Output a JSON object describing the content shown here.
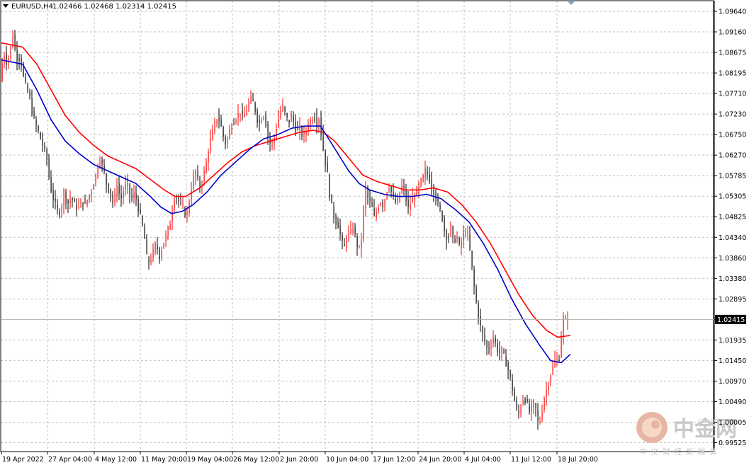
{
  "header": {
    "symbol": "EURUSD,H4",
    "quote": "1.02466 1.02468 1.02314 1.02415"
  },
  "watermark": {
    "brand": "中金网",
    "domain": "CNGOLD.ORG",
    "tagline": "中 文 财 经 新 媒 体"
  },
  "colors": {
    "bull": "#ff0000",
    "bear": "#000000",
    "ma_slow": "#ff0000",
    "ma_fast": "#0000cc",
    "grid": "#c0c0c0",
    "price_tag": "#000000"
  },
  "chart_data": {
    "type": "candlestick",
    "title": "EURUSD,H4",
    "ylim": [
      0.99525,
      1.0964
    ],
    "y_ticks": [
      "1.09640",
      "1.09160",
      "1.08675",
      "1.08195",
      "1.07710",
      "1.07230",
      "1.06750",
      "1.06270",
      "1.05785",
      "1.05305",
      "1.04825",
      "1.04340",
      "1.03860",
      "1.03380",
      "1.02895",
      "1.02415",
      "1.01935",
      "1.01450",
      "1.00970",
      "1.00490",
      "1.00005",
      "0.99525"
    ],
    "x_labels": [
      "19 Apr 2022",
      "27 Apr 04:00",
      "4 May 12:00",
      "11 May 20:00",
      "19 May 04:00",
      "26 May 12:00",
      "2 Jun 20:00",
      "10 Jun 04:00",
      "17 Jun 12:00",
      "24 Jun 20:00",
      "4 Jul 04:00",
      "11 Jul 12:00",
      "18 Jul 20:00"
    ],
    "current_price": "1.02415",
    "path_points": [
      [
        0,
        1.08
      ],
      [
        5,
        1.087
      ],
      [
        10,
        1.084
      ],
      [
        15,
        1.088
      ],
      [
        19,
        1.092
      ],
      [
        22,
        1.085
      ],
      [
        26,
        1.086
      ],
      [
        30,
        1.084
      ],
      [
        34,
        1.08
      ],
      [
        38,
        1.078
      ],
      [
        42,
        1.076
      ],
      [
        46,
        1.072
      ],
      [
        50,
        1.07
      ],
      [
        54,
        1.068
      ],
      [
        58,
        1.066
      ],
      [
        62,
        1.064
      ],
      [
        66,
        1.062
      ],
      [
        70,
        1.056
      ],
      [
        74,
        1.053
      ],
      [
        78,
        1.051
      ],
      [
        82,
        1.049
      ],
      [
        86,
        1.05
      ],
      [
        90,
        1.054
      ],
      [
        95,
        1.051
      ],
      [
        100,
        1.053
      ],
      [
        105,
        1.051
      ],
      [
        110,
        1.05
      ],
      [
        115,
        1.052
      ],
      [
        120,
        1.051
      ],
      [
        125,
        1.053
      ],
      [
        130,
        1.055
      ],
      [
        135,
        1.058
      ],
      [
        140,
        1.062
      ],
      [
        145,
        1.06
      ],
      [
        150,
        1.056
      ],
      [
        155,
        1.054
      ],
      [
        160,
        1.051
      ],
      [
        165,
        1.056
      ],
      [
        170,
        1.052
      ],
      [
        175,
        1.055
      ],
      [
        180,
        1.056
      ],
      [
        185,
        1.052
      ],
      [
        190,
        1.054
      ],
      [
        195,
        1.05
      ],
      [
        200,
        1.047
      ],
      [
        205,
        1.042
      ],
      [
        208,
        1.037
      ],
      [
        212,
        1.038
      ],
      [
        216,
        1.04
      ],
      [
        220,
        1.042
      ],
      [
        225,
        1.039
      ],
      [
        230,
        1.042
      ],
      [
        235,
        1.044
      ],
      [
        240,
        1.047
      ],
      [
        243,
        1.05
      ],
      [
        247,
        1.054
      ],
      [
        251,
        1.052
      ],
      [
        255,
        1.051
      ],
      [
        259,
        1.05
      ],
      [
        263,
        1.048
      ],
      [
        267,
        1.052
      ],
      [
        271,
        1.056
      ],
      [
        276,
        1.059
      ],
      [
        281,
        1.055
      ],
      [
        286,
        1.057
      ],
      [
        290,
        1.06
      ],
      [
        294,
        1.064
      ],
      [
        298,
        1.067
      ],
      [
        303,
        1.07
      ],
      [
        307,
        1.072
      ],
      [
        311,
        1.07
      ],
      [
        315,
        1.067
      ],
      [
        319,
        1.065
      ],
      [
        323,
        1.068
      ],
      [
        327,
        1.07
      ],
      [
        331,
        1.071
      ],
      [
        335,
        1.072
      ],
      [
        339,
        1.073
      ],
      [
        343,
        1.071
      ],
      [
        347,
        1.073
      ],
      [
        351,
        1.075
      ],
      [
        355,
        1.076
      ],
      [
        359,
        1.074
      ],
      [
        363,
        1.071
      ],
      [
        367,
        1.07
      ],
      [
        371,
        1.073
      ],
      [
        375,
        1.07
      ],
      [
        379,
        1.066
      ],
      [
        383,
        1.065
      ],
      [
        387,
        1.067
      ],
      [
        391,
        1.07
      ],
      [
        395,
        1.073
      ],
      [
        399,
        1.074
      ],
      [
        403,
        1.072
      ],
      [
        407,
        1.07
      ],
      [
        411,
        1.072
      ],
      [
        415,
        1.07
      ],
      [
        419,
        1.068
      ],
      [
        423,
        1.069
      ],
      [
        427,
        1.067
      ],
      [
        431,
        1.068
      ],
      [
        435,
        1.07
      ],
      [
        439,
        1.071
      ],
      [
        443,
        1.072
      ],
      [
        447,
        1.07
      ],
      [
        451,
        1.072
      ],
      [
        454,
        1.066
      ],
      [
        458,
        1.062
      ],
      [
        462,
        1.058
      ],
      [
        466,
        1.052
      ],
      [
        470,
        1.049
      ],
      [
        474,
        1.047
      ],
      [
        478,
        1.046
      ],
      [
        482,
        1.042
      ],
      [
        486,
        1.041
      ],
      [
        490,
        1.045
      ],
      [
        494,
        1.044
      ],
      [
        498,
        1.046
      ],
      [
        502,
        1.043
      ],
      [
        506,
        1.04
      ],
      [
        510,
        1.043
      ],
      [
        513,
        1.05
      ],
      [
        516,
        1.055
      ],
      [
        520,
        1.052
      ],
      [
        524,
        1.051
      ],
      [
        528,
        1.048
      ],
      [
        532,
        1.05
      ],
      [
        536,
        1.052
      ],
      [
        540,
        1.051
      ],
      [
        544,
        1.053
      ],
      [
        548,
        1.056
      ],
      [
        552,
        1.054
      ],
      [
        556,
        1.052
      ],
      [
        560,
        1.051
      ],
      [
        564,
        1.054
      ],
      [
        568,
        1.056
      ],
      [
        572,
        1.053
      ],
      [
        576,
        1.05
      ],
      [
        580,
        1.052
      ],
      [
        584,
        1.053
      ],
      [
        588,
        1.054
      ],
      [
        592,
        1.056
      ],
      [
        596,
        1.057
      ],
      [
        600,
        1.059
      ],
      [
        604,
        1.058
      ],
      [
        608,
        1.056
      ],
      [
        612,
        1.054
      ],
      [
        616,
        1.052
      ],
      [
        620,
        1.05
      ],
      [
        624,
        1.048
      ],
      [
        628,
        1.044
      ],
      [
        632,
        1.043
      ],
      [
        636,
        1.046
      ],
      [
        640,
        1.042
      ],
      [
        644,
        1.044
      ],
      [
        648,
        1.041
      ],
      [
        652,
        1.043
      ],
      [
        656,
        1.045
      ],
      [
        660,
        1.044
      ],
      [
        664,
        1.039
      ],
      [
        668,
        1.033
      ],
      [
        672,
        1.028
      ],
      [
        676,
        1.024
      ],
      [
        680,
        1.021
      ],
      [
        684,
        1.019
      ],
      [
        688,
        1.017
      ],
      [
        692,
        1.018
      ],
      [
        696,
        1.02
      ],
      [
        700,
        1.018
      ],
      [
        704,
        1.016
      ],
      [
        708,
        1.017
      ],
      [
        712,
        1.015
      ],
      [
        716,
        1.013
      ],
      [
        720,
        1.01
      ],
      [
        724,
        1.007
      ],
      [
        728,
        1.003
      ],
      [
        732,
        1.002
      ],
      [
        736,
        1.005
      ],
      [
        740,
        1.006
      ],
      [
        744,
        1.004
      ],
      [
        748,
        1.002
      ],
      [
        752,
        1.005
      ],
      [
        756,
        1.003
      ],
      [
        760,
        0.999
      ],
      [
        764,
        1.002
      ],
      [
        768,
        1.006
      ],
      [
        772,
        1.008
      ],
      [
        776,
        1.011
      ],
      [
        780,
        1.013
      ],
      [
        784,
        1.015
      ],
      [
        788,
        1.014
      ],
      [
        791,
        1.018
      ],
      [
        794,
        1.025
      ],
      [
        797,
        1.023
      ],
      [
        800,
        1.025
      ],
      [
        803,
        1.0242
      ]
    ],
    "ma_slow": [
      [
        0,
        1.089
      ],
      [
        30,
        1.088
      ],
      [
        50,
        1.084
      ],
      [
        70,
        1.078
      ],
      [
        90,
        1.072
      ],
      [
        110,
        1.068
      ],
      [
        130,
        1.065
      ],
      [
        150,
        1.0625
      ],
      [
        170,
        1.061
      ],
      [
        190,
        1.0595
      ],
      [
        210,
        1.057
      ],
      [
        230,
        1.0545
      ],
      [
        245,
        1.053
      ],
      [
        260,
        1.053
      ],
      [
        280,
        1.055
      ],
      [
        300,
        1.058
      ],
      [
        320,
        1.061
      ],
      [
        340,
        1.0635
      ],
      [
        360,
        1.065
      ],
      [
        380,
        1.066
      ],
      [
        400,
        1.067
      ],
      [
        420,
        1.068
      ],
      [
        440,
        1.0685
      ],
      [
        455,
        1.068
      ],
      [
        470,
        1.066
      ],
      [
        490,
        1.062
      ],
      [
        510,
        1.058
      ],
      [
        530,
        1.0565
      ],
      [
        550,
        1.0555
      ],
      [
        570,
        1.0545
      ],
      [
        590,
        1.0545
      ],
      [
        610,
        1.055
      ],
      [
        630,
        1.054
      ],
      [
        650,
        1.051
      ],
      [
        670,
        1.047
      ],
      [
        690,
        1.042
      ],
      [
        710,
        1.036
      ],
      [
        730,
        1.03
      ],
      [
        750,
        1.025
      ],
      [
        770,
        1.0215
      ],
      [
        785,
        1.02
      ],
      [
        803,
        1.0204
      ]
    ],
    "ma_fast": [
      [
        0,
        1.085
      ],
      [
        30,
        1.084
      ],
      [
        50,
        1.078
      ],
      [
        70,
        1.071
      ],
      [
        90,
        1.066
      ],
      [
        110,
        1.063
      ],
      [
        130,
        1.0605
      ],
      [
        150,
        1.059
      ],
      [
        170,
        1.0575
      ],
      [
        190,
        1.056
      ],
      [
        210,
        1.053
      ],
      [
        225,
        1.0505
      ],
      [
        240,
        1.049
      ],
      [
        255,
        1.0495
      ],
      [
        270,
        1.051
      ],
      [
        290,
        1.054
      ],
      [
        310,
        1.058
      ],
      [
        330,
        1.061
      ],
      [
        350,
        1.064
      ],
      [
        370,
        1.0665
      ],
      [
        390,
        1.0675
      ],
      [
        410,
        1.069
      ],
      [
        430,
        1.0695
      ],
      [
        450,
        1.0695
      ],
      [
        460,
        1.067
      ],
      [
        475,
        1.063
      ],
      [
        490,
        1.059
      ],
      [
        505,
        1.056
      ],
      [
        520,
        1.0545
      ],
      [
        540,
        1.0535
      ],
      [
        560,
        1.053
      ],
      [
        580,
        1.053
      ],
      [
        600,
        1.0535
      ],
      [
        620,
        1.0525
      ],
      [
        640,
        1.05
      ],
      [
        660,
        1.047
      ],
      [
        680,
        1.042
      ],
      [
        700,
        1.036
      ],
      [
        720,
        1.029
      ],
      [
        740,
        1.023
      ],
      [
        760,
        1.018
      ],
      [
        775,
        1.0145
      ],
      [
        790,
        1.014
      ],
      [
        803,
        1.016
      ]
    ]
  }
}
